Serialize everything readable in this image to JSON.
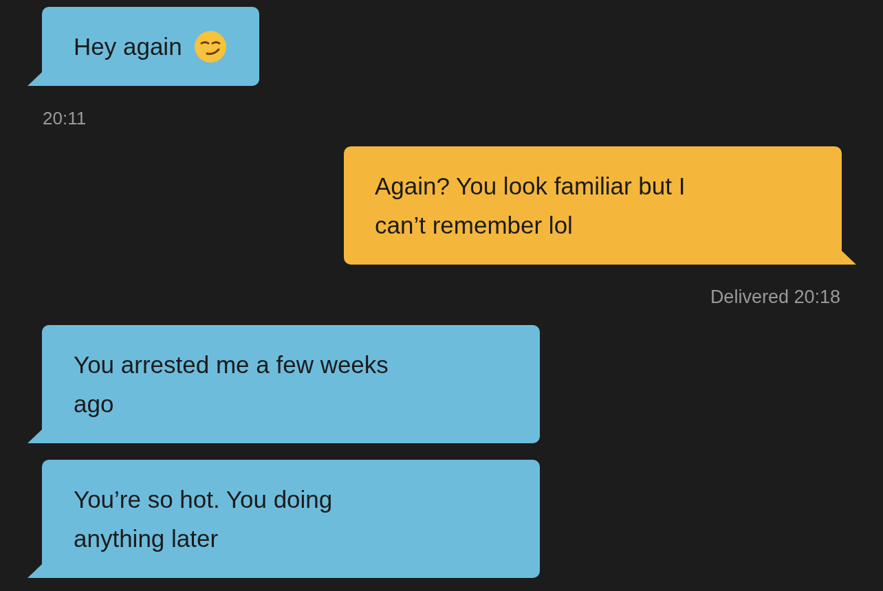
{
  "items": [
    {
      "kind": "received",
      "lines": [
        "Hey again"
      ]
    },
    {
      "kind": "time",
      "text": "20:11"
    },
    {
      "kind": "sent",
      "lines": [
        "Again? You look familiar but I",
        "can’t remember lol"
      ]
    },
    {
      "kind": "status",
      "text": "Delivered 20:18"
    },
    {
      "kind": "received",
      "lines": [
        "You arrested me a few weeks",
        "ago"
      ]
    },
    {
      "kind": "received",
      "lines": [
        "You’re so hot. You doing",
        "anything later"
      ]
    }
  ]
}
